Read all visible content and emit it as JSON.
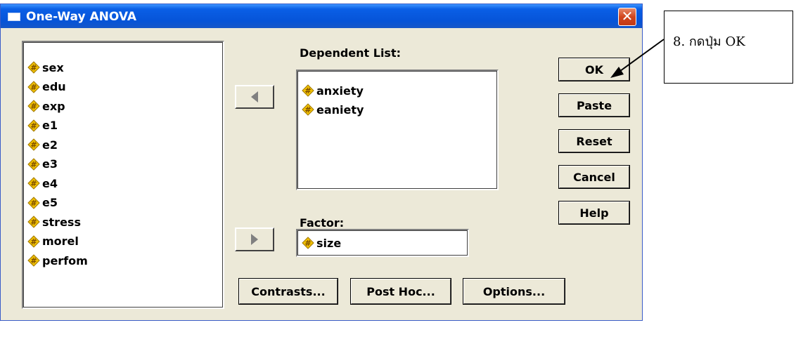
{
  "window": {
    "title": "One-Way ANOVA"
  },
  "variables": [
    "sex",
    "edu",
    "exp",
    "e1",
    "e2",
    "e3",
    "e4",
    "e5",
    "stress",
    "morel",
    "perfom"
  ],
  "dependent": {
    "label": "Dependent List:",
    "items": [
      "anxiety",
      "eaniety"
    ]
  },
  "factor": {
    "label": "Factor:",
    "value": "size"
  },
  "side_buttons": {
    "ok": "OK",
    "paste": "Paste",
    "reset": "Reset",
    "cancel": "Cancel",
    "help": "Help"
  },
  "bottom_buttons": {
    "contrasts": "Contrasts...",
    "post_hoc": "Post Hoc...",
    "options": "Options..."
  },
  "annotation": {
    "text": "8. กดปุ่ม OK"
  },
  "colors": {
    "titlebar": "#0654d8",
    "dialog_bg": "#ece9d8",
    "var_icon": "#f0c000"
  }
}
